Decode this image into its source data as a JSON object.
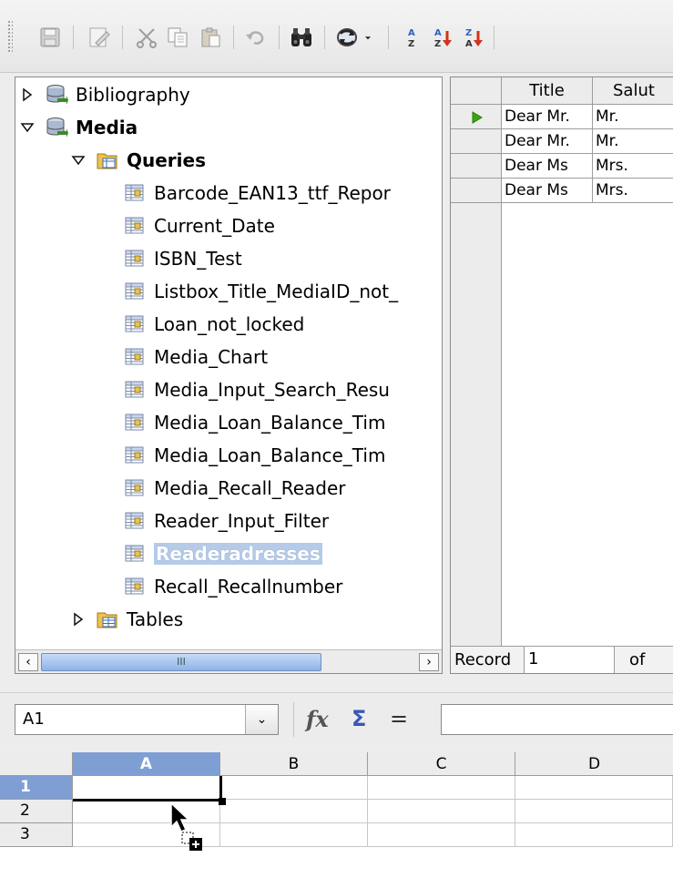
{
  "toolbar": {
    "icons": [
      "save-icon",
      "edit-icon",
      "cut-icon",
      "copy-icon",
      "paste-icon",
      "undo-icon",
      "find-icon",
      "refresh-icon",
      "dropdown-arrow-icon",
      "sort-icon",
      "sort-ascending-icon",
      "sort-descending-icon"
    ]
  },
  "tree": {
    "bibliography": "Bibliography",
    "media": "Media",
    "queries": "Queries",
    "query_items": [
      "Barcode_EAN13_ttf_Repor",
      "Current_Date",
      "ISBN_Test",
      "Listbox_Title_MediaID_not_",
      "Loan_not_locked",
      "Media_Chart",
      "Media_Input_Search_Resu",
      "Media_Loan_Balance_Tim",
      "Media_Loan_Balance_Tim",
      "Media_Recall_Reader",
      "Reader_Input_Filter",
      "Readeradresses",
      "Recall_Recallnumber"
    ],
    "tables": "Tables",
    "scroll_grip": "III"
  },
  "data_grid": {
    "columns": [
      "Title",
      "Salut"
    ],
    "rows": [
      [
        "Dear Mr.",
        "Mr."
      ],
      [
        "Dear Mr.",
        "Mr."
      ],
      [
        "Dear Ms",
        "Mrs."
      ],
      [
        "Dear Ms",
        "Mrs."
      ]
    ],
    "footer": {
      "record_label": "Record",
      "record_value": "1",
      "of_label": "of"
    }
  },
  "formula_bar": {
    "name_box": "A1",
    "function_wizard_icon": "fx",
    "sum_icon": "Σ",
    "equals_icon": "="
  },
  "sheet": {
    "columns": [
      "A",
      "B",
      "C",
      "D"
    ],
    "rows": [
      "1",
      "2",
      "3"
    ]
  },
  "colors": {
    "selection": "#b5cbe8",
    "header_active": "#7f9fd4",
    "arrow_green": "#3aa510"
  }
}
